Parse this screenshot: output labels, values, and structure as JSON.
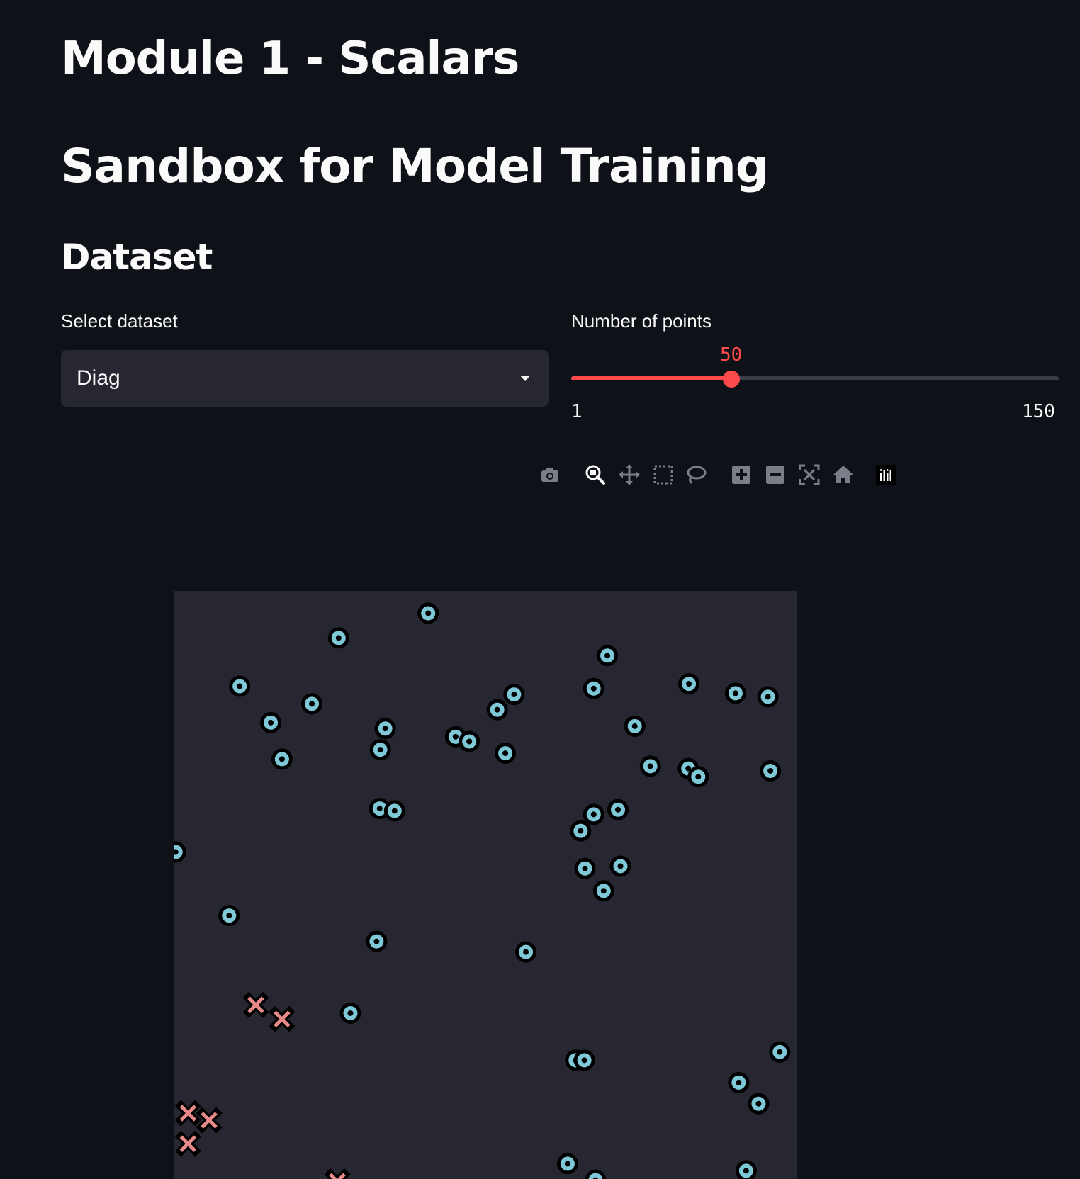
{
  "header": {
    "title": "Module 1 - Scalars",
    "subtitle": "Sandbox for Model Training",
    "section": "Dataset"
  },
  "dataset_select": {
    "label": "Select dataset",
    "value": "Diag"
  },
  "points_slider": {
    "label": "Number of points",
    "value": "50",
    "min": "1",
    "max": "150",
    "fraction": 0.329
  },
  "modebar": {
    "buttons": [
      "camera-icon",
      "zoom-icon",
      "pan-icon",
      "box-select-icon",
      "lasso-select-icon",
      "zoom-in-icon",
      "zoom-out-icon",
      "autoscale-icon",
      "reset-axes-icon",
      "plotly-logo-icon"
    ]
  },
  "colors": {
    "accent": "#ff4b4b",
    "plot_bg": "#262730",
    "class_circle": "#7ec8d8",
    "class_cross": "#e88a8a"
  },
  "chart_data": {
    "type": "scatter",
    "title": "",
    "xlabel": "",
    "ylabel": "",
    "xlim": [
      0,
      1
    ],
    "ylim": [
      0,
      1
    ],
    "grid": false,
    "legend": "none",
    "series": [
      {
        "marker": "circle",
        "points": [
          [
            0.408,
            0.962
          ],
          [
            0.264,
            0.92
          ],
          [
            0.105,
            0.838
          ],
          [
            0.221,
            0.808
          ],
          [
            0.696,
            0.89
          ],
          [
            0.674,
            0.834
          ],
          [
            0.827,
            0.842
          ],
          [
            0.902,
            0.826
          ],
          [
            0.954,
            0.82
          ],
          [
            0.155,
            0.776
          ],
          [
            0.339,
            0.766
          ],
          [
            0.331,
            0.73
          ],
          [
            0.452,
            0.752
          ],
          [
            0.474,
            0.744
          ],
          [
            0.519,
            0.798
          ],
          [
            0.546,
            0.824
          ],
          [
            0.532,
            0.724
          ],
          [
            0.74,
            0.77
          ],
          [
            0.173,
            0.714
          ],
          [
            0.765,
            0.702
          ],
          [
            0.826,
            0.698
          ],
          [
            0.842,
            0.684
          ],
          [
            0.958,
            0.694
          ],
          [
            0.33,
            0.63
          ],
          [
            0.354,
            0.626
          ],
          [
            0.674,
            0.62
          ],
          [
            0.713,
            0.628
          ],
          [
            0.653,
            0.592
          ],
          [
            0.002,
            0.556
          ],
          [
            0.088,
            0.448
          ],
          [
            0.325,
            0.404
          ],
          [
            0.565,
            0.386
          ],
          [
            0.66,
            0.528
          ],
          [
            0.717,
            0.532
          ],
          [
            0.69,
            0.49
          ],
          [
            0.283,
            0.282
          ],
          [
            0.645,
            0.202
          ],
          [
            0.659,
            0.202
          ],
          [
            0.973,
            0.216
          ],
          [
            0.907,
            0.164
          ],
          [
            0.939,
            0.128
          ],
          [
            0.632,
            0.026
          ],
          [
            0.677,
            -0.002
          ],
          [
            0.919,
            0.014
          ]
        ]
      },
      {
        "marker": "x",
        "points": [
          [
            0.131,
            0.296
          ],
          [
            0.173,
            0.272
          ],
          [
            0.022,
            0.112
          ],
          [
            0.056,
            0.1
          ],
          [
            0.022,
            0.06
          ],
          [
            0.262,
            -0.004
          ]
        ]
      }
    ]
  }
}
